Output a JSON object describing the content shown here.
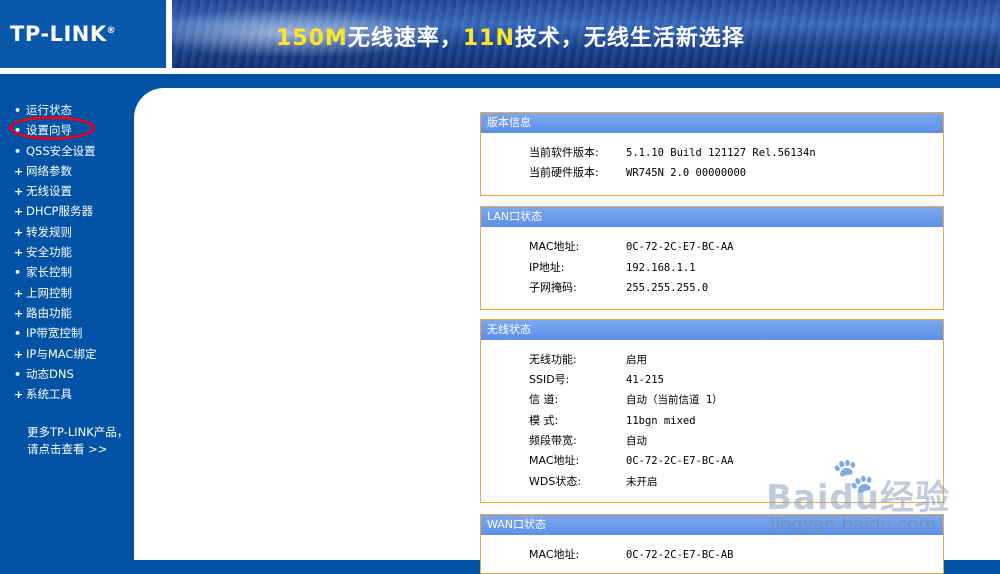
{
  "header": {
    "logo": "TP-LINK",
    "logo_mark": "®",
    "banner_parts": [
      "150M",
      "无线速率，",
      "11N",
      "技术，无线生活新选择"
    ]
  },
  "sidebar": {
    "items": [
      {
        "bullet": "•",
        "label": "运行状态"
      },
      {
        "bullet": "•",
        "label": "设置向导"
      },
      {
        "bullet": "•",
        "label": "QSS安全设置"
      },
      {
        "bullet": "+",
        "label": "网络参数"
      },
      {
        "bullet": "+",
        "label": "无线设置"
      },
      {
        "bullet": "+",
        "label": "DHCP服务器"
      },
      {
        "bullet": "+",
        "label": "转发规则"
      },
      {
        "bullet": "+",
        "label": "安全功能"
      },
      {
        "bullet": "•",
        "label": "家长控制"
      },
      {
        "bullet": "+",
        "label": "上网控制"
      },
      {
        "bullet": "+",
        "label": "路由功能"
      },
      {
        "bullet": "•",
        "label": "IP带宽控制"
      },
      {
        "bullet": "+",
        "label": "IP与MAC绑定"
      },
      {
        "bullet": "•",
        "label": "动态DNS"
      },
      {
        "bullet": "+",
        "label": "系统工具"
      }
    ],
    "more_line1": "更多TP-LINK产品，",
    "more_line2": "请点击查看 >>"
  },
  "panels": {
    "version": {
      "title": "版本信息",
      "rows": [
        {
          "label": "当前软件版本:",
          "value": "5.1.10 Build 121127 Rel.56134n"
        },
        {
          "label": "当前硬件版本:",
          "value": "WR745N 2.0 00000000"
        }
      ]
    },
    "lan": {
      "title": "LAN口状态",
      "rows": [
        {
          "label": "MAC地址:",
          "value": "0C-72-2C-E7-BC-AA"
        },
        {
          "label": "IP地址:",
          "value": "192.168.1.1"
        },
        {
          "label": "子网掩码:",
          "value": "255.255.255.0"
        }
      ]
    },
    "wireless": {
      "title": "无线状态",
      "rows": [
        {
          "label": "无线功能:",
          "value": "启用"
        },
        {
          "label": "SSID号:",
          "value": "41-215"
        },
        {
          "label": "信 道:",
          "value": "自动（当前信道 1）"
        },
        {
          "label": "模 式:",
          "value": "11bgn mixed"
        },
        {
          "label": "频段带宽:",
          "value": "自动"
        },
        {
          "label": "MAC地址:",
          "value": "0C-72-2C-E7-BC-AA"
        },
        {
          "label": "WDS状态:",
          "value": "未开启"
        }
      ]
    },
    "wan": {
      "title": "WAN口状态",
      "rows": [
        {
          "label": "MAC地址:",
          "value": "0C-72-2C-E7-BC-AB"
        }
      ]
    }
  },
  "watermark": {
    "brand": "Baidu经验",
    "url": "jingyan.baidu.com"
  }
}
